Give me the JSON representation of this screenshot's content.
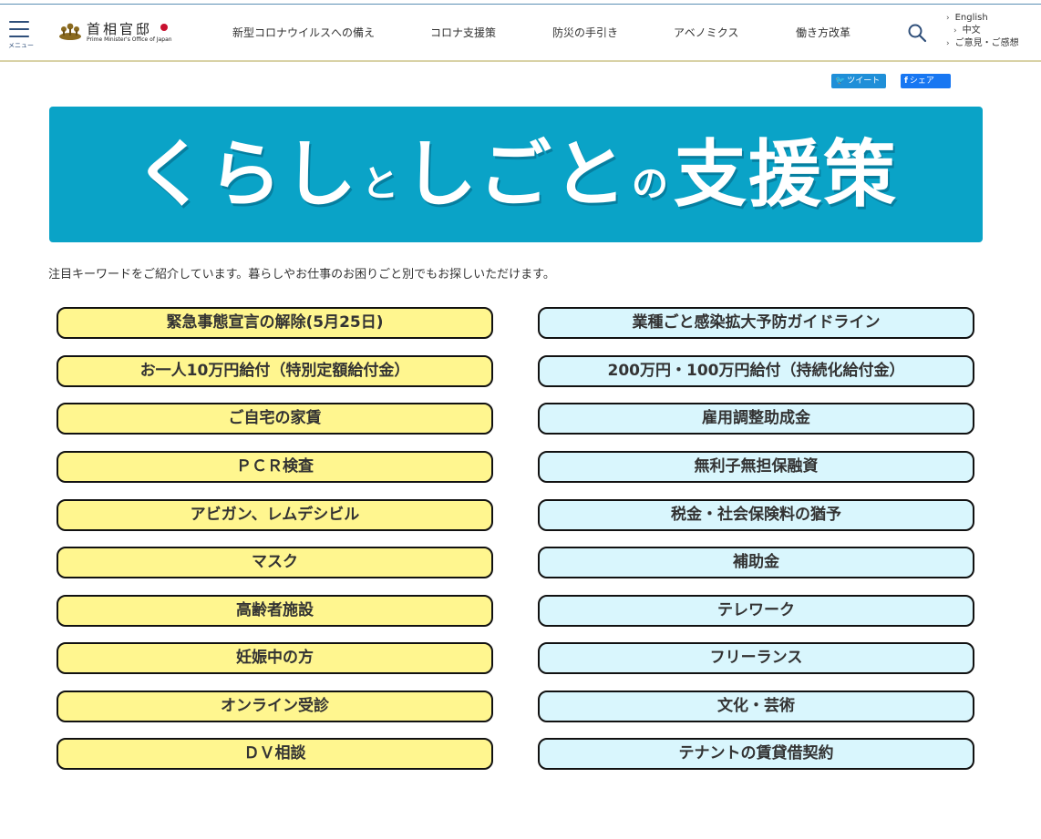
{
  "header": {
    "menu_label": "メニュー",
    "logo_jp": "首相官邸",
    "logo_en": "Prime Minister's Office of Japan",
    "nav": [
      {
        "label": "新型コロナウイルスへの備え"
      },
      {
        "label": "コロナ支援策"
      },
      {
        "label": "防災の手引き"
      },
      {
        "label": "アベノミクス"
      },
      {
        "label": "働き方改革"
      }
    ],
    "lang_links": [
      {
        "label": "English"
      },
      {
        "label": "中文"
      },
      {
        "label": "ご意見・ご感想"
      }
    ]
  },
  "share": {
    "tweet": "ツイート",
    "share": "シェア"
  },
  "banner": {
    "part1": "くらし",
    "part2": "と",
    "part3": "しごと",
    "part4": "の",
    "part5": "支援策"
  },
  "intro": "注目キーワードをご紹介しています。暮らしやお仕事のお困りごと別でもお探しいただけます。",
  "keywords_left": [
    "緊急事態宣言の解除(5月25日)",
    "お一人10万円給付（特別定額給付金）",
    "ご自宅の家賃",
    "ＰＣＲ検査",
    "アビガン、レムデシビル",
    "マスク",
    "高齢者施設",
    "妊娠中の方",
    "オンライン受診",
    "ＤＶ相談"
  ],
  "keywords_right": [
    "業種ごと感染拡大予防ガイドライン",
    "200万円・100万円給付（持続化給付金）",
    "雇用調整助成金",
    "無利子無担保融資",
    "税金・社会保険料の猶予",
    "補助金",
    "テレワーク",
    "フリーランス",
    "文化・芸術",
    "テナントの賃貸借契約"
  ],
  "colors": {
    "banner_bg": "#0aa3c7",
    "left_button_bg": "#fff68f",
    "right_button_bg": "#d9f6fd",
    "button_border": "#111111",
    "tweet_bg": "#1f8fd8",
    "facebook_bg": "#1877f2"
  }
}
